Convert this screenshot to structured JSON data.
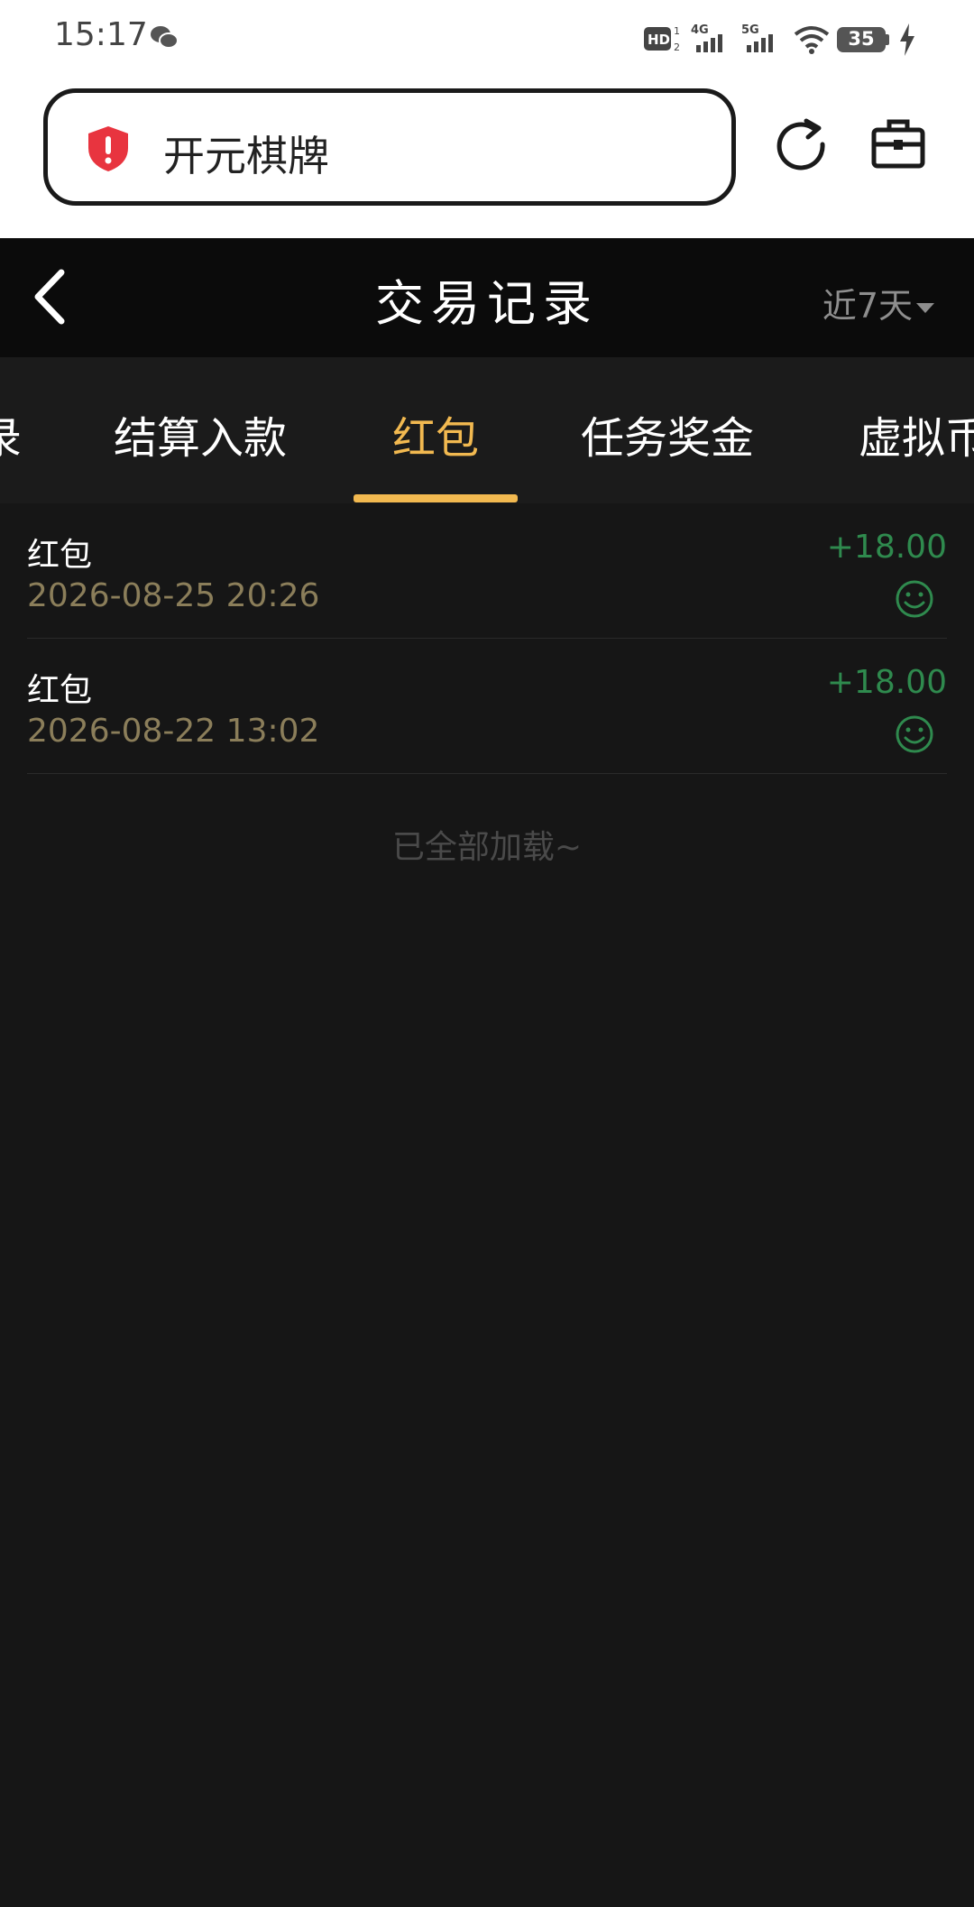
{
  "status_bar": {
    "time": "15:17",
    "battery": "35",
    "icons": [
      "wechat-icon",
      "hd-icon",
      "signal-4g-icon",
      "signal-5g-icon",
      "wifi-icon",
      "battery-icon",
      "charging-icon"
    ]
  },
  "browser": {
    "url_text": "开元棋牌",
    "icons": [
      "shield-alert-icon",
      "reload-icon",
      "toolbox-icon"
    ],
    "shield_color": "#e8343f"
  },
  "header": {
    "title": "交易记录",
    "date_filter": "近7天"
  },
  "tabs": [
    {
      "label": "录"
    },
    {
      "label": "结算入款"
    },
    {
      "label": "红包",
      "active": true
    },
    {
      "label": "任务奖金"
    },
    {
      "label": "虚拟币"
    }
  ],
  "records": [
    {
      "name": "红包",
      "date": "2026-08-25 20:26",
      "amount": "+18.00"
    },
    {
      "name": "红包",
      "date": "2026-08-22 13:02",
      "amount": "+18.00"
    }
  ],
  "footer": {
    "load_done": "已全部加载~"
  },
  "colors": {
    "accent": "#f2b950",
    "amount_green": "#2f8a4e",
    "date_text": "#8b7e5a"
  }
}
